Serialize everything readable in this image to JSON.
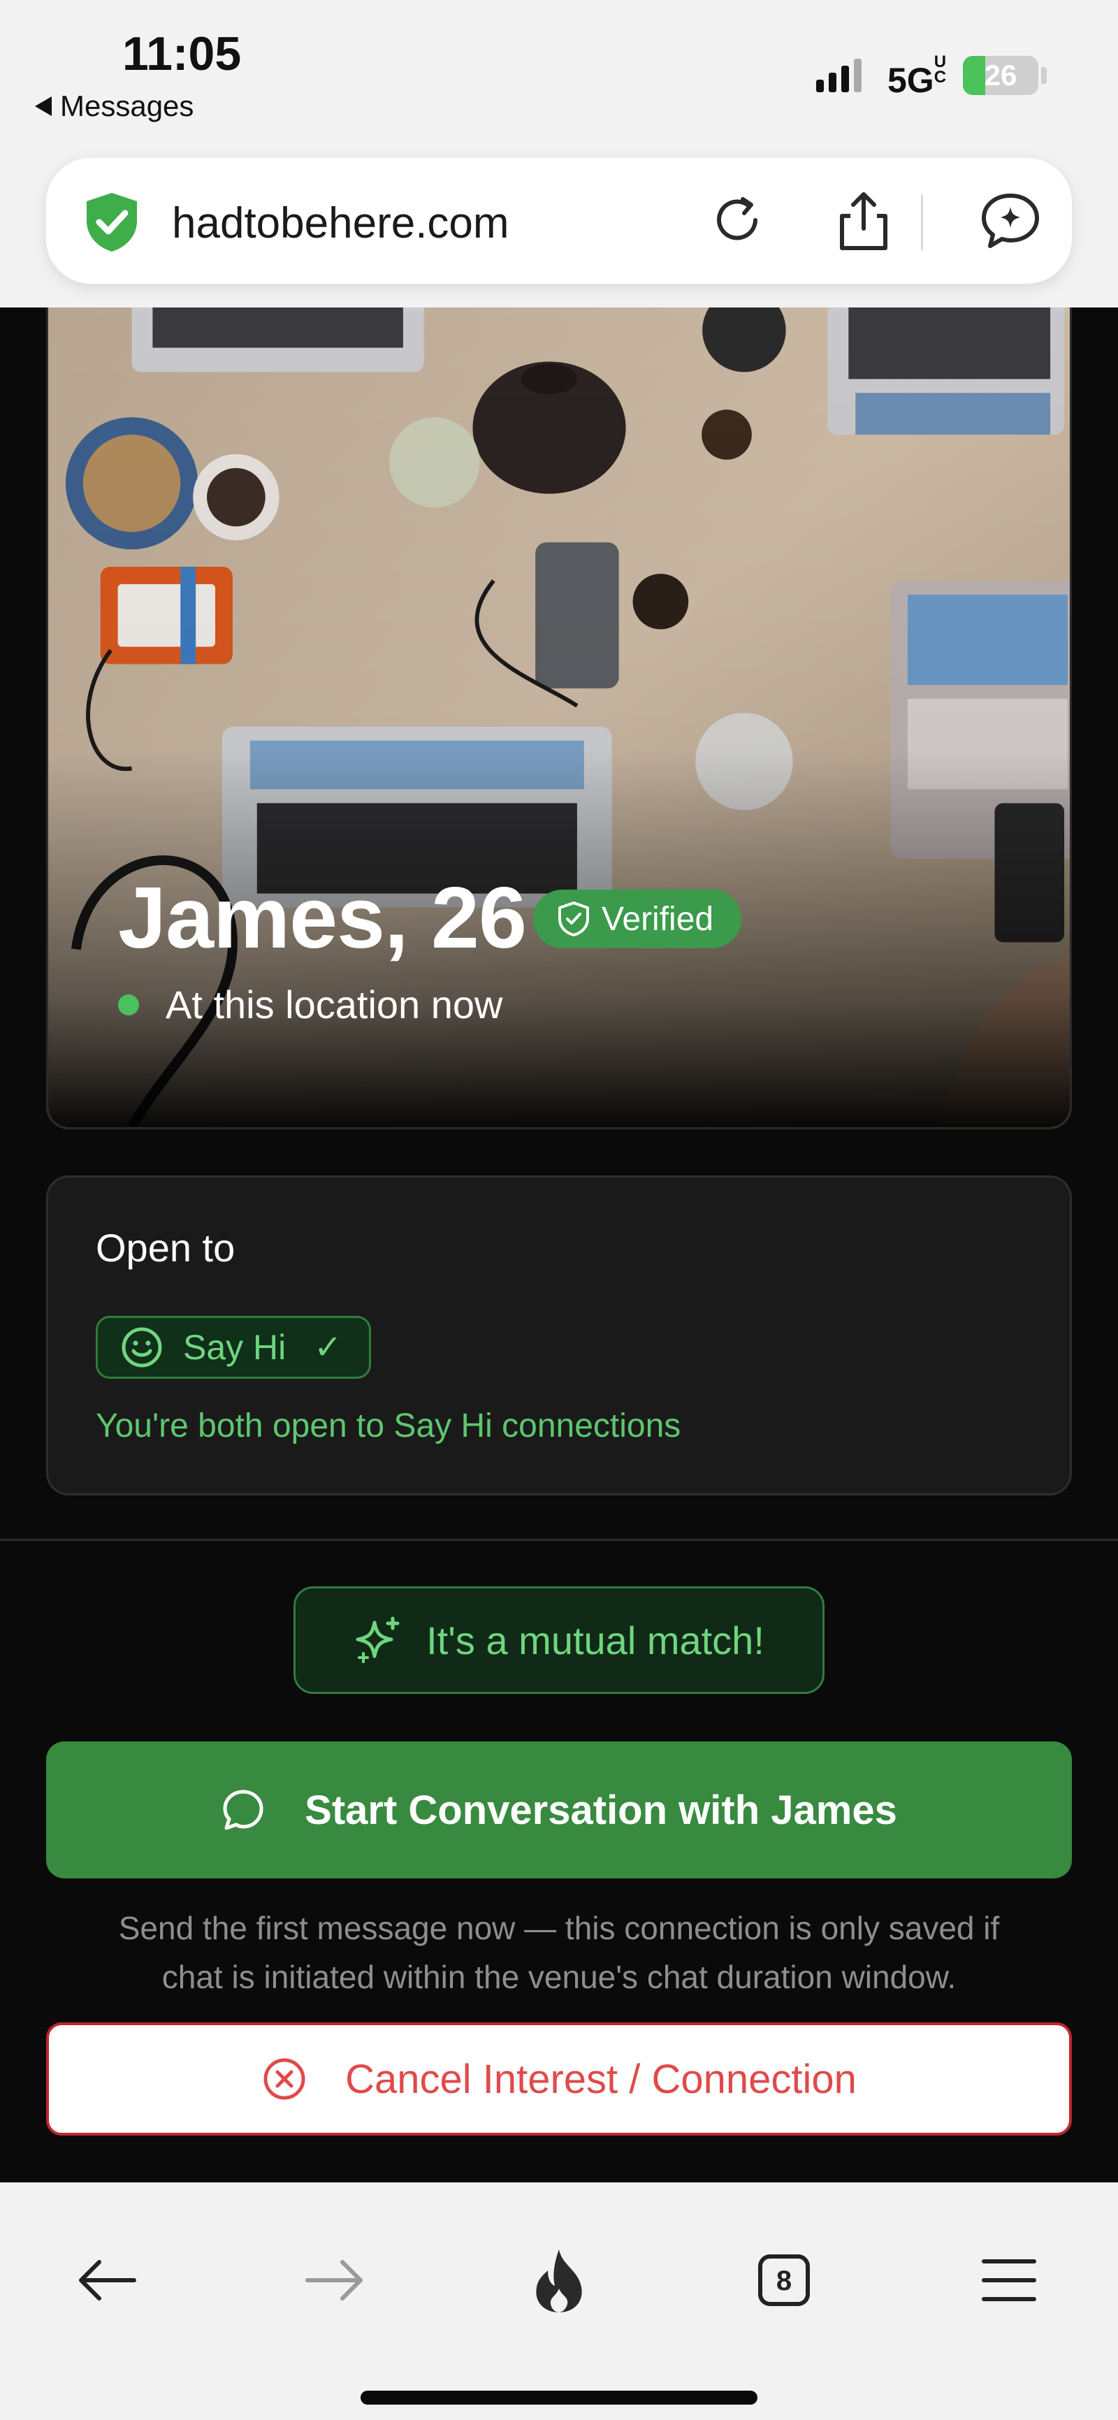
{
  "status_bar": {
    "time": "11:05",
    "back_app": "Messages",
    "network": "5G",
    "network_sub": "UC",
    "battery": "26"
  },
  "browser": {
    "url": "hadtobehere.com",
    "tabs_count": "8"
  },
  "profile": {
    "name_age": "James, 26",
    "verified_label": "Verified",
    "presence_text": "At this location now"
  },
  "open_to": {
    "title": "Open to",
    "chip_label": "Say Hi",
    "chip_check": "✓",
    "note": "You're both open to Say Hi connections"
  },
  "match": {
    "label": "It's a mutual match!"
  },
  "actions": {
    "start_label": "Start Conversation with James",
    "help_text": "Send the first message now — this connection is only saved if chat is initiated within the venue's chat duration window.",
    "cancel_label": "Cancel Interest / Connection"
  },
  "colors": {
    "accent_green": "#388a40",
    "match_green": "#6fd67f",
    "danger_red": "#e04a4a",
    "background": "#0b0a0a"
  }
}
